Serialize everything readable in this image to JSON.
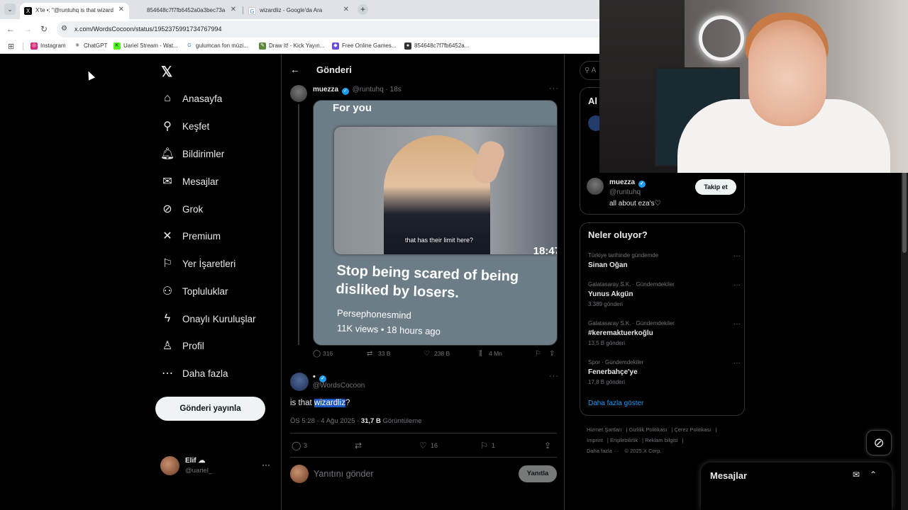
{
  "browser": {
    "tabs": [
      {
        "title": "X'te •: \"@runtuhq is that wizard",
        "active": true
      },
      {
        "title": "854648c7f7fb6452a0a3bec73a",
        "active": false
      },
      {
        "title": "wizardliz - Google'da Ara",
        "active": false
      }
    ],
    "url": "x.com/WordsCocoon/status/1952375991734767994",
    "bookmarks": [
      "Instagram",
      "ChatGPT",
      "Uariel Stream - Wat...",
      "gulumcan fon müzi...",
      "Draw It! - Kick Yayın...",
      "Free Online Games...",
      "854648c7f7fb6452a..."
    ]
  },
  "nav": {
    "items": [
      "Anasayfa",
      "Keşfet",
      "Bildirimler",
      "Mesajlar",
      "Grok",
      "Premium",
      "Yer İşaretleri",
      "Topluluklar",
      "Onaylı Kuruluşlar",
      "Profil",
      "Daha fazla"
    ],
    "icons": [
      "home-icon",
      "search-icon",
      "bell-icon",
      "mail-icon",
      "grok-icon",
      "x-premium-icon",
      "bookmark-icon",
      "communities-icon",
      "lightning-icon",
      "person-icon",
      "more-circle-icon"
    ],
    "post_button": "Gönderi yayınla",
    "account": {
      "name": "Elif ☁",
      "handle": "@uariel_"
    }
  },
  "main": {
    "title": "Gönderi",
    "quoted": {
      "name": "muezza",
      "handle": "@runtuhq · 18s",
      "media": {
        "for_you": "For you",
        "caption": "that has their limit here?",
        "time": "18:47",
        "headline": "Stop being scared of being disliked by losers.",
        "source": "Persephonesmind",
        "views": "11K views • 18 hours ago"
      },
      "stats": {
        "replies": "316",
        "reposts": "33 B",
        "likes": "238 B",
        "views": "4 Mn"
      }
    },
    "post": {
      "name": "•",
      "handle": "@WordsCocoon",
      "text_before": "is that ",
      "text_highlight": "wizardliz",
      "text_after": "?",
      "timestamp": "ÖS 5:28 · 4 Ağu 2025 · ",
      "views_count": "31,7 B",
      "views_label": " Görüntüleme",
      "replies": "3",
      "likes": "16",
      "bookmarks": "1"
    },
    "reply_placeholder": "Yanıtını gönder",
    "reply_button": "Yanıtla"
  },
  "right": {
    "search_stub": "A",
    "who_to_follow_title": "Al",
    "suggest": {
      "name": "muezza",
      "handle": "@runtuhq",
      "bio": "all about eza's♡",
      "follow": "Takip et"
    },
    "trends_title": "Neler oluyor?",
    "trends": [
      {
        "context": "Türkiye tarihinde gündemde",
        "title": "Sinan Oğan",
        "count": ""
      },
      {
        "context": "Galatasaray S.K. · Gündemdekiler",
        "title": "Yunus Akgün",
        "count": "3.389 gönderi"
      },
      {
        "context": "Galatasaray S.K. · Gündemdekiler",
        "title": "#keremaktuerkoğlu",
        "count": "13,5 B gönderi"
      },
      {
        "context": "Spor · Gündemdekiler",
        "title": "Fenerbahçe'ye",
        "count": "17,8 B gönderi"
      }
    ],
    "show_more": "Daha fazla göster",
    "footer": [
      "Hizmet Şartları",
      "Gizlilik Politikası",
      "Çerez Politikası",
      "Imprint",
      "Erişilebilirlik",
      "Reklam bilgisi",
      "Daha fazla ···",
      "© 2025 X Corp."
    ]
  },
  "messages": {
    "title": "Mesajlar"
  },
  "colors": {
    "accent": "#1d9bf0",
    "background": "#000000",
    "border": "#2f3336",
    "muted": "#71767b",
    "highlight": "#1a56c4"
  }
}
